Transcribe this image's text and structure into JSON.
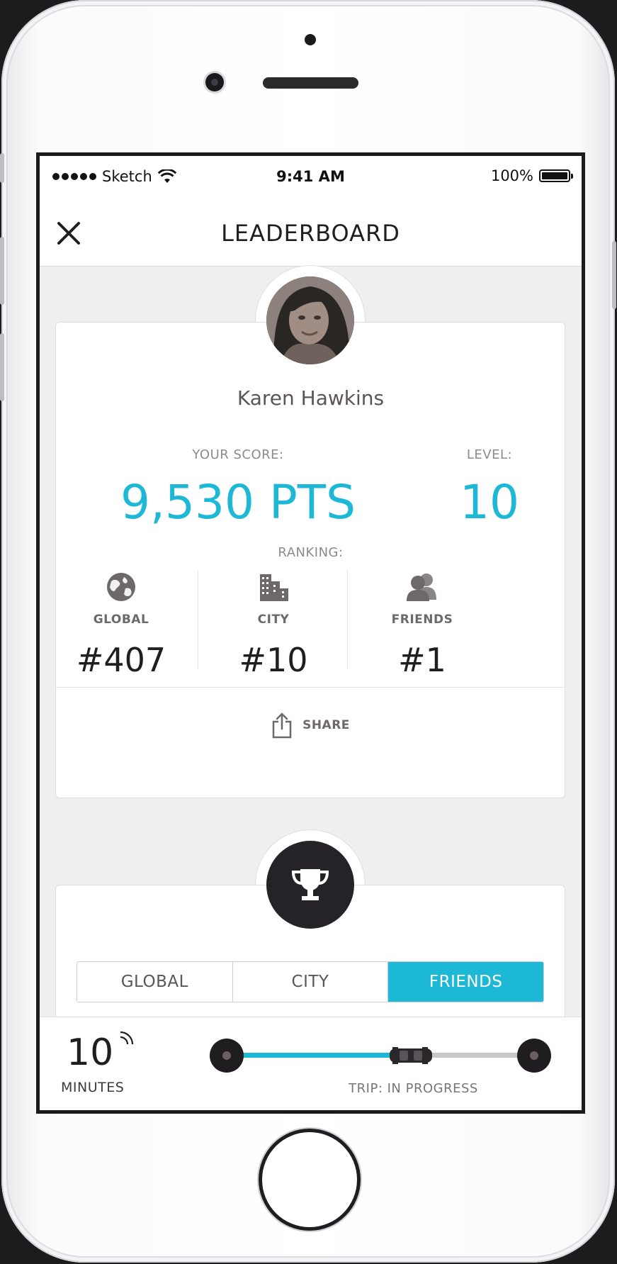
{
  "status_bar": {
    "carrier": "Sketch",
    "time": "9:41 AM",
    "battery": "100%"
  },
  "header": {
    "title": "LEADERBOARD",
    "close_icon": "close-icon"
  },
  "profile": {
    "name": "Karen Hawkins",
    "score_label": "YOUR SCORE:",
    "score_value": "9,530 PTS",
    "level_label": "LEVEL:",
    "level_value": "10",
    "ranking_label": "RANKING:",
    "rankings": [
      {
        "icon": "globe-icon",
        "label": "GLOBAL",
        "value": "#407"
      },
      {
        "icon": "city-icon",
        "label": "CITY",
        "value": "#10"
      },
      {
        "icon": "friends-icon",
        "label": "FRIENDS",
        "value": "#1"
      }
    ],
    "share_label": "SHARE"
  },
  "leaderboard": {
    "icon": "trophy-icon",
    "tabs": [
      {
        "label": "GLOBAL",
        "active": false
      },
      {
        "label": "CITY",
        "active": false
      },
      {
        "label": "FRIENDS",
        "active": true
      }
    ]
  },
  "trip": {
    "eta_value": "10",
    "eta_unit": "MINUTES",
    "status": "TRIP: IN PROGRESS",
    "progress": 0.62
  },
  "colors": {
    "accent": "#1cb8d6",
    "dark": "#252327",
    "text": "#1f1f22"
  }
}
